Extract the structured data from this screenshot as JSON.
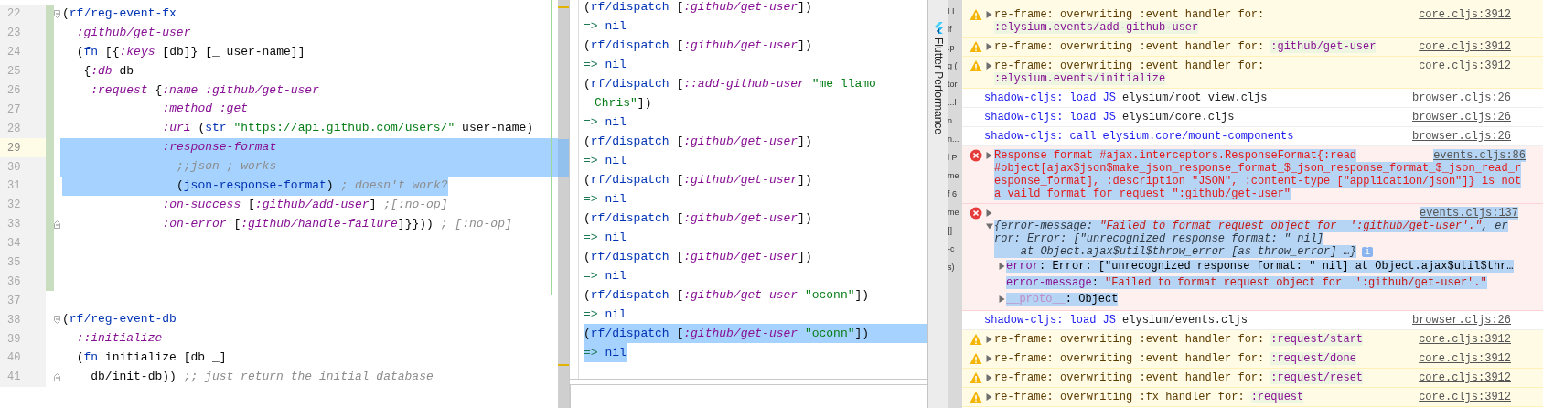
{
  "editor": {
    "lines": [
      {
        "number": "22",
        "changed": true,
        "caret": false,
        "foldable": true,
        "fold_end": false,
        "selected": false,
        "text": "(rf/reg-event-fx"
      },
      {
        "number": "23",
        "changed": true,
        "caret": false,
        "foldable": false,
        "fold_end": false,
        "selected": false,
        "text": "  :github/get-user"
      },
      {
        "number": "24",
        "changed": true,
        "caret": false,
        "foldable": false,
        "fold_end": false,
        "selected": false,
        "text": "  (fn [{:keys [db]} [_ user-name]]"
      },
      {
        "number": "25",
        "changed": true,
        "caret": false,
        "foldable": false,
        "fold_end": false,
        "selected": false,
        "text": "   {:db db"
      },
      {
        "number": "26",
        "changed": true,
        "caret": false,
        "foldable": false,
        "fold_end": false,
        "selected": false,
        "text": "    :request {:name :github/get-user"
      },
      {
        "number": "27",
        "changed": true,
        "caret": false,
        "foldable": false,
        "fold_end": false,
        "selected": false,
        "text": "              :method :get"
      },
      {
        "number": "28",
        "changed": true,
        "caret": false,
        "foldable": false,
        "fold_end": false,
        "selected": false,
        "text": "              :uri (str \"https://api.github.com/users/\" user-name)"
      },
      {
        "number": "29",
        "changed": true,
        "caret": true,
        "foldable": false,
        "fold_end": false,
        "selected": true,
        "text": "              :response-format"
      },
      {
        "number": "30",
        "changed": true,
        "caret": false,
        "foldable": false,
        "fold_end": false,
        "selected": true,
        "text": "                ;;json ; works"
      },
      {
        "number": "31",
        "changed": true,
        "caret": false,
        "foldable": false,
        "fold_end": false,
        "selected": true,
        "text": "                (json-response-format) ; doesn't work?"
      },
      {
        "number": "32",
        "changed": true,
        "caret": false,
        "foldable": false,
        "fold_end": false,
        "selected": false,
        "text": "              :on-success [:github/add-user] ;[:no-op]"
      },
      {
        "number": "33",
        "changed": true,
        "caret": false,
        "foldable": false,
        "fold_end": true,
        "selected": false,
        "text": "              :on-error [:github/handle-failure]}})) ; [:no-op]"
      },
      {
        "number": "34",
        "changed": true,
        "caret": false,
        "foldable": false,
        "fold_end": false
      },
      {
        "number": "35",
        "changed": true,
        "caret": false,
        "foldable": false,
        "fold_end": false
      },
      {
        "number": "36",
        "changed": true,
        "caret": false,
        "foldable": false,
        "fold_end": false
      },
      {
        "number": "37",
        "changed": false,
        "caret": false,
        "foldable": false,
        "fold_end": false
      },
      {
        "number": "38",
        "changed": false,
        "caret": false,
        "foldable": true,
        "fold_end": false,
        "selected": false,
        "text": "(rf/reg-event-db"
      },
      {
        "number": "39",
        "changed": false,
        "caret": false,
        "foldable": false,
        "fold_end": false,
        "selected": false,
        "text": "  ::initialize"
      },
      {
        "number": "40",
        "changed": false,
        "caret": false,
        "foldable": false,
        "fold_end": false,
        "selected": false,
        "text": "  (fn initialize [db _]"
      },
      {
        "number": "41",
        "changed": false,
        "caret": false,
        "foldable": false,
        "fold_end": true,
        "selected": false,
        "text": "    db/init-db)) ;; just return the initial database"
      }
    ]
  },
  "repl": {
    "lines": [
      {
        "kind": "input",
        "selected": false,
        "text": "(rf/dispatch [:github/get-user])"
      },
      {
        "kind": "result",
        "selected": false,
        "text": "=> nil"
      },
      {
        "kind": "input",
        "selected": false,
        "text": "(rf/dispatch [:github/get-user])"
      },
      {
        "kind": "result",
        "selected": false,
        "text": "=> nil"
      },
      {
        "kind": "input",
        "selected": false,
        "text": "(rf/dispatch [::add-github-user \"me llamo Chris\"])"
      },
      {
        "kind": "result",
        "selected": false,
        "text": "=> nil"
      },
      {
        "kind": "input",
        "selected": false,
        "text": "(rf/dispatch [:github/get-user])"
      },
      {
        "kind": "result",
        "selected": false,
        "text": "=> nil"
      },
      {
        "kind": "input",
        "selected": false,
        "text": "(rf/dispatch [:github/get-user])"
      },
      {
        "kind": "result",
        "selected": false,
        "text": "=> nil"
      },
      {
        "kind": "input",
        "selected": false,
        "text": "(rf/dispatch [:github/get-user])"
      },
      {
        "kind": "result",
        "selected": false,
        "text": "=> nil"
      },
      {
        "kind": "input",
        "selected": false,
        "text": "(rf/dispatch [:github/get-user])"
      },
      {
        "kind": "result",
        "selected": false,
        "text": "=> nil"
      },
      {
        "kind": "input",
        "selected": false,
        "text": "(rf/dispatch [:github/get-user \"oconn\"])"
      },
      {
        "kind": "result",
        "selected": false,
        "text": "=> nil"
      },
      {
        "kind": "input",
        "selected": true,
        "text": "(rf/dispatch [:github/get-user \"oconn\"])"
      },
      {
        "kind": "result",
        "selected": true,
        "text": "=> nil"
      }
    ]
  },
  "tool_window": {
    "title": "Flutter Performance"
  },
  "hidden_panel": {
    "fragments": [
      "I I",
      "lf",
      ".p",
      "g (",
      "tor",
      "...l",
      "n",
      "n...",
      "l P",
      "me",
      "f 6",
      "me",
      "]]",
      "-c",
      "s)"
    ]
  },
  "console": {
    "rows": [
      {
        "kind": "warning",
        "expanded": false,
        "message": "re-frame: overwriting :event handler for:",
        "keyword": ":elysium.events/add-github-user",
        "source": "core.cljs:3912"
      },
      {
        "kind": "warning",
        "expanded": false,
        "message": "re-frame: overwriting :event handler for:",
        "keyword": ":github/get-user",
        "source": "core.cljs:3912"
      },
      {
        "kind": "warning",
        "expanded": false,
        "message": "re-frame: overwriting :event handler for:",
        "keyword": ":elysium.events/initialize",
        "source": "core.cljs:3912"
      },
      {
        "kind": "info",
        "parts": [
          {
            "text": "shadow-cljs: load JS",
            "kind": "label"
          },
          {
            "text": "elysium/root_view.cljs",
            "kind": "value"
          }
        ],
        "source": "browser.cljs:26"
      },
      {
        "kind": "info",
        "parts": [
          {
            "text": "shadow-cljs: load JS",
            "kind": "label"
          },
          {
            "text": "elysium/core.cljs",
            "kind": "value"
          }
        ],
        "source": "browser.cljs:26"
      },
      {
        "kind": "info",
        "parts": [
          {
            "text": "shadow-cljs: call elysium.core/mount-components",
            "kind": "label"
          }
        ],
        "source": "browser.cljs:26"
      },
      {
        "kind": "error",
        "expanded": false,
        "highlighted": true,
        "message": "Response format #ajax.interceptors.ResponseFormat{:read #object[ajax$json$make_json_response_format_$_json_response_format_$_json_read_response_format], :description \"JSON\", :content-type [\"application/json\"]} is not a vaild format for request \":github/get-user\"",
        "source": "events.cljs:86"
      },
      {
        "kind": "error_object",
        "expanded": false,
        "highlighted": true,
        "source": "events.cljs:137",
        "object": {
          "expanded": true,
          "info_badge": "i",
          "summary": "{error-message: \"Failed to format request object for  ':github/get-user'.\", error: Error: [\"unrecognized response format: \" nil]\n    at Object.ajax$util$throw_error [as throw_error] …}",
          "properties": [
            {
              "expanded": false,
              "dimmed": false,
              "text": "error: Error: [\"unrecognized response format: \" nil] at Object.ajax$util$thr…"
            },
            {
              "dimmed": false,
              "text": "error-message: \"Failed to format request object for  ':github/get-user'.\""
            },
            {
              "expanded": false,
              "dimmed": true,
              "text": "__proto__: Object"
            }
          ]
        }
      },
      {
        "kind": "info",
        "parts": [
          {
            "text": "shadow-cljs: load JS",
            "kind": "label"
          },
          {
            "text": "elysium/events.cljs",
            "kind": "value"
          }
        ],
        "source": "browser.cljs:26"
      },
      {
        "kind": "warning",
        "expanded": false,
        "message": "re-frame: overwriting :event handler for:",
        "keyword": ":request/start",
        "source": "core.cljs:3912"
      },
      {
        "kind": "warning",
        "expanded": false,
        "message": "re-frame: overwriting :event handler for:",
        "keyword": ":request/done",
        "source": "core.cljs:3912"
      },
      {
        "kind": "warning",
        "expanded": false,
        "message": "re-frame: overwriting :event handler for:",
        "keyword": ":request/reset",
        "source": "core.cljs:3912"
      },
      {
        "kind": "warning",
        "expanded": false,
        "message": "re-frame: overwriting :fx handler for:",
        "keyword": ":request",
        "source": "core.cljs:3912"
      }
    ]
  }
}
